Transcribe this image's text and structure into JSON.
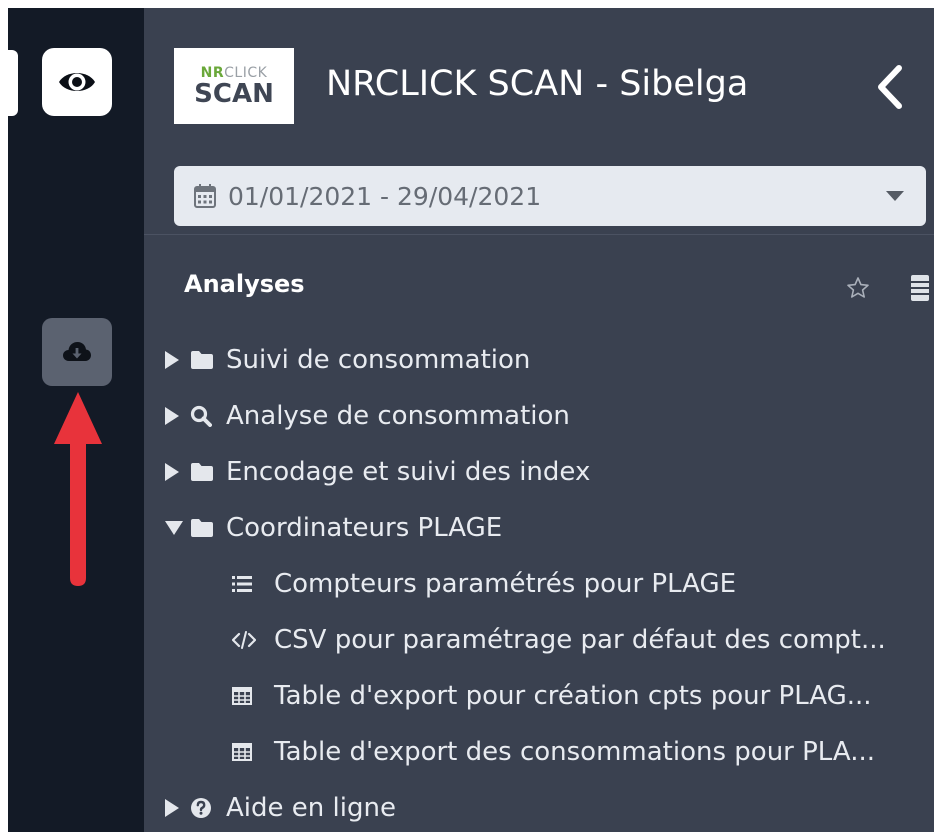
{
  "header": {
    "title": "NRCLICK SCAN - Sibelga",
    "logo": {
      "line1_a": "NR",
      "line1_b": "CLICK",
      "line2": "SCAN"
    }
  },
  "date_range": {
    "value": "01/01/2021 - 29/04/2021"
  },
  "section": {
    "title": "Analyses"
  },
  "tree": {
    "folders": [
      {
        "label": "Suivi de consommation",
        "icon": "folder-icon",
        "expanded": false
      },
      {
        "label": "Analyse de consommation",
        "icon": "search-icon",
        "expanded": false
      },
      {
        "label": "Encodage et suivi des index",
        "icon": "folder-icon",
        "expanded": false
      },
      {
        "label": "Coordinateurs PLAGE",
        "icon": "folder-icon",
        "expanded": true
      }
    ],
    "children": [
      {
        "label": "Compteurs paramétrés pour PLAGE",
        "icon": "list-icon"
      },
      {
        "label": "CSV pour paramétrage par défaut des compt...",
        "icon": "code-icon"
      },
      {
        "label": "Table d'export pour création cpts pour PLAG...",
        "icon": "table-icon"
      },
      {
        "label": "Table d'export des consommations pour PLA...",
        "icon": "table-icon"
      }
    ],
    "help": {
      "label": "Aide en ligne",
      "icon": "help-icon",
      "expanded": false
    }
  },
  "colors": {
    "rail": "#131a26",
    "panel": "#3a4150",
    "annotation_arrow": "#e8333b",
    "logo_green": "#6aa83a"
  }
}
